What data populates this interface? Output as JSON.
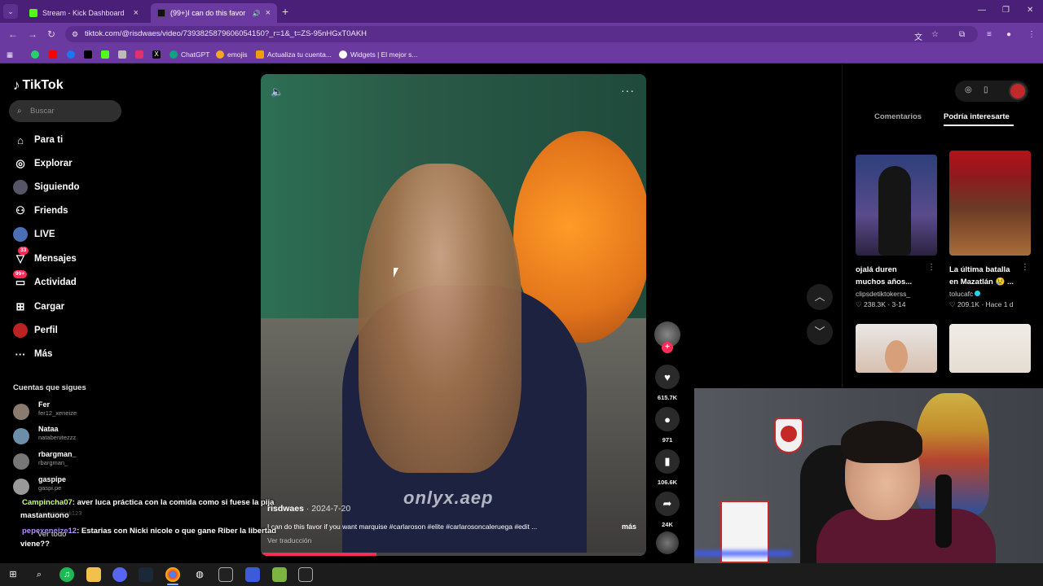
{
  "browser": {
    "tabs": [
      {
        "title": "Stream - Kick Dashboard",
        "favicon_color": "#53fc18",
        "active": false
      },
      {
        "title": "(99+)I can do this favor if y",
        "favicon_color": "#111111",
        "active": true
      }
    ],
    "new_tab_label": "+",
    "url": "tiktok.com/@risdwaes/video/7393825879606054150?_r=1&_t=ZS-95nHGxT0AKH",
    "bookmarks": [
      {
        "label": "",
        "color": "#25d366"
      },
      {
        "label": "",
        "color": "#ff0000"
      },
      {
        "label": "",
        "color": "#1877f2"
      },
      {
        "label": "",
        "color": "#000000"
      },
      {
        "label": "",
        "color": "#53fc18"
      },
      {
        "label": "",
        "color": "#888888"
      },
      {
        "label": "",
        "color": "#e1306c"
      },
      {
        "label": "",
        "color": "#000000"
      },
      {
        "label": "ChatGPT",
        "color": "#10a37f"
      },
      {
        "label": "emojis",
        "color": "#f5a623"
      },
      {
        "label": "Actualiza tu cuenta...",
        "color": "#f29f05"
      },
      {
        "label": "Widgets | El mejor s...",
        "color": "#222222"
      }
    ]
  },
  "tiktok": {
    "logo_text": "TikTok",
    "search_placeholder": "Buscar",
    "nav": [
      {
        "label": "Para ti",
        "icon": "home-icon",
        "badge": ""
      },
      {
        "label": "Explorar",
        "icon": "compass-icon",
        "badge": ""
      },
      {
        "label": "Siguiendo",
        "icon": "following-icon",
        "badge": ""
      },
      {
        "label": "Friends",
        "icon": "friends-icon",
        "badge": ""
      },
      {
        "label": "LIVE",
        "icon": "live-icon",
        "badge": ""
      },
      {
        "label": "Mensajes",
        "icon": "messages-icon",
        "badge": "33"
      },
      {
        "label": "Actividad",
        "icon": "activity-icon",
        "badge": "99+"
      },
      {
        "label": "Cargar",
        "icon": "upload-icon",
        "badge": ""
      },
      {
        "label": "Perfil",
        "icon": "profile-icon",
        "badge": ""
      },
      {
        "label": "Más",
        "icon": "more-icon",
        "badge": ""
      }
    ],
    "following_heading": "Cuentas que sigues",
    "following": [
      {
        "name": "Fer",
        "handle": "fer12_xeneize"
      },
      {
        "name": "Nataa",
        "handle": "natabenitezzz"
      },
      {
        "name": "rbargman_",
        "handle": "rbargman_"
      },
      {
        "name": "gaspipe",
        "handle": "gaspi.pe"
      },
      {
        "name": "",
        "handle": "lucaromerali123"
      }
    ],
    "video": {
      "author": "risdwaes",
      "date": "2024-7-20",
      "caption": "I can do this favor if you want marquise #carlaroson #elite #carlarosoncaleruega #edit ...",
      "more_label": "más",
      "translate_label": "Ver traducción",
      "watermark": "onlyx.aep",
      "progress_fraction": 0.3
    },
    "actions": {
      "likes": "615.7K",
      "comments": "971",
      "saves": "106.6K",
      "shares": "24K"
    },
    "side_tabs": {
      "comments": "Comentarios",
      "interest": "Podría interesarte"
    },
    "suggestions": [
      {
        "title": "ojalá duren muchos años...",
        "user": "clipsdetiktokerss_",
        "verified": false,
        "likes": "238.3K",
        "date": "3-14"
      },
      {
        "title": "La última batalla en Mazatlán 😢 ...",
        "user": "tolucafc",
        "verified": true,
        "likes": "209.1K",
        "date": "Hace 1 d"
      }
    ]
  },
  "chat_overlay": [
    {
      "user": "Campincha07",
      "message": ": aver luca práctica con la comida como si fuese la pija"
    },
    {
      "user": "",
      "message": "mastantuono"
    },
    {
      "user": "pepexeneize12",
      "message": ": Estarias con Nicki nicole o que gane Riber la libertad"
    },
    {
      "user": "",
      "message": "Ver todo"
    },
    {
      "user": "",
      "message": "viene??"
    }
  ],
  "colors": {
    "browser_frame": "#4a1f78",
    "browser_toolbar": "#6b3aa0",
    "tiktok_accent": "#fe2c55",
    "chat_user1": "#c9ff7a",
    "chat_user2": "#b58cff"
  }
}
